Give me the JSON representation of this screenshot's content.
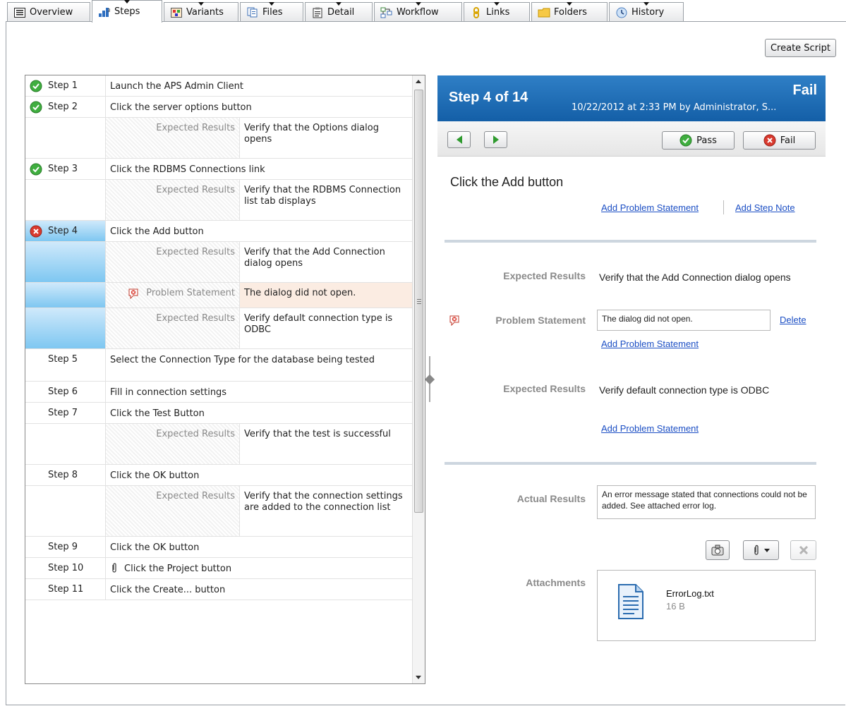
{
  "tabs": [
    {
      "label": "Overview",
      "icon": "overview-icon"
    },
    {
      "label": "Steps",
      "icon": "steps-icon"
    },
    {
      "label": "Variants",
      "icon": "variants-icon"
    },
    {
      "label": "Files",
      "icon": "files-icon"
    },
    {
      "label": "Detail",
      "icon": "detail-icon"
    },
    {
      "label": "Workflow",
      "icon": "workflow-icon"
    },
    {
      "label": "Links",
      "icon": "links-icon"
    },
    {
      "label": "Folders",
      "icon": "folder-icon"
    },
    {
      "label": "History",
      "icon": "history-icon"
    }
  ],
  "toolbar": {
    "create_script": "Create Script"
  },
  "steps": [
    {
      "label": "Step 1",
      "text": "Launch the APS Admin Client",
      "status": "pass"
    },
    {
      "label": "Step 2",
      "text": "Click the server options button",
      "status": "pass",
      "subs": [
        {
          "key": "Expected Results",
          "value": "Verify that the Options dialog opens"
        }
      ]
    },
    {
      "label": "Step 3",
      "text": "Click the RDBMS Connections link",
      "status": "pass",
      "subs": [
        {
          "key": "Expected Results",
          "value": "Verify that the RDBMS Connection list tab displays"
        }
      ]
    },
    {
      "label": "Step 4",
      "text": "Click the Add button",
      "status": "fail",
      "subs": [
        {
          "key": "Expected Results",
          "value": "Verify that the Add Connection dialog opens"
        },
        {
          "key": "Problem Statement",
          "value": "The dialog did not open."
        },
        {
          "key": "Expected Results",
          "value": "Verify default connection type is ODBC"
        }
      ]
    },
    {
      "label": "Step 5",
      "text": "Select the Connection Type for the database being tested"
    },
    {
      "label": "Step 6",
      "text": "Fill in connection settings"
    },
    {
      "label": "Step 7",
      "text": "Click the Test Button",
      "subs": [
        {
          "key": "Expected Results",
          "value": "Verify that the test is successful"
        }
      ]
    },
    {
      "label": "Step 8",
      "text": "Click the OK button",
      "subs": [
        {
          "key": "Expected Results",
          "value": "Verify that the connection settings are added to the connection list"
        }
      ]
    },
    {
      "label": "Step 9",
      "text": "Click the OK button"
    },
    {
      "label": "Step 10",
      "text": "Click the Project button"
    },
    {
      "label": "Step 11",
      "text": "Click the Create... button"
    }
  ],
  "detail": {
    "step_of": "Step 4 of 14",
    "state": "Fail",
    "meta": "10/22/2012 at 2:33 PM by Administrator, S...",
    "pass_label": "Pass",
    "fail_label": "Fail",
    "instruction": "Click the Add button",
    "add_problem": "Add Problem Statement",
    "add_note": "Add Step Note",
    "expected_label": "Expected Results",
    "expected_1": "Verify that the Add Connection dialog opens",
    "problem_label": "Problem Statement",
    "problem_value": "The dialog did not open.",
    "delete": "Delete",
    "expected_2": "Verify default connection type is ODBC",
    "actual_label": "Actual Results",
    "actual_value": "An error message stated that connections could not be added. See attached error log.",
    "attachments_label": "Attachments",
    "file_name": "ErrorLog.txt",
    "file_size": "16 B"
  }
}
